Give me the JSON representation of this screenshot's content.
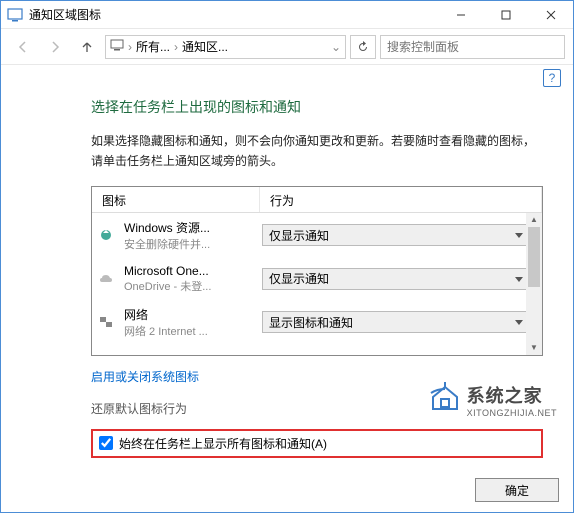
{
  "titlebar": {
    "title": "通知区域图标"
  },
  "nav": {
    "seg1": "所有...",
    "seg2": "通知区...",
    "search_placeholder": "搜索控制面板"
  },
  "content": {
    "heading": "选择在任务栏上出现的图标和通知",
    "desc": "如果选择隐藏图标和通知，则不会向你通知更改和更新。若要随时查看隐藏的图标，请单击任务栏上通知区域旁的箭头。",
    "col_icon": "图标",
    "col_action": "行为",
    "rows": [
      {
        "title": "Windows 资源...",
        "sub": "安全删除硬件并...",
        "action": "仅显示通知"
      },
      {
        "title": "Microsoft One...",
        "sub": "OneDrive - 未登...",
        "action": "仅显示通知"
      },
      {
        "title": "网络",
        "sub": "网络 2 Internet ...",
        "action": "显示图标和通知"
      }
    ],
    "link": "启用或关闭系统图标",
    "restore_label": "还原默认图标行为",
    "checkbox_label": "始终在任务栏上显示所有图标和通知(A)",
    "ok": "确定"
  },
  "watermark": {
    "cn": "系统之家",
    "en": "XITONGZHIJIA.NET"
  }
}
